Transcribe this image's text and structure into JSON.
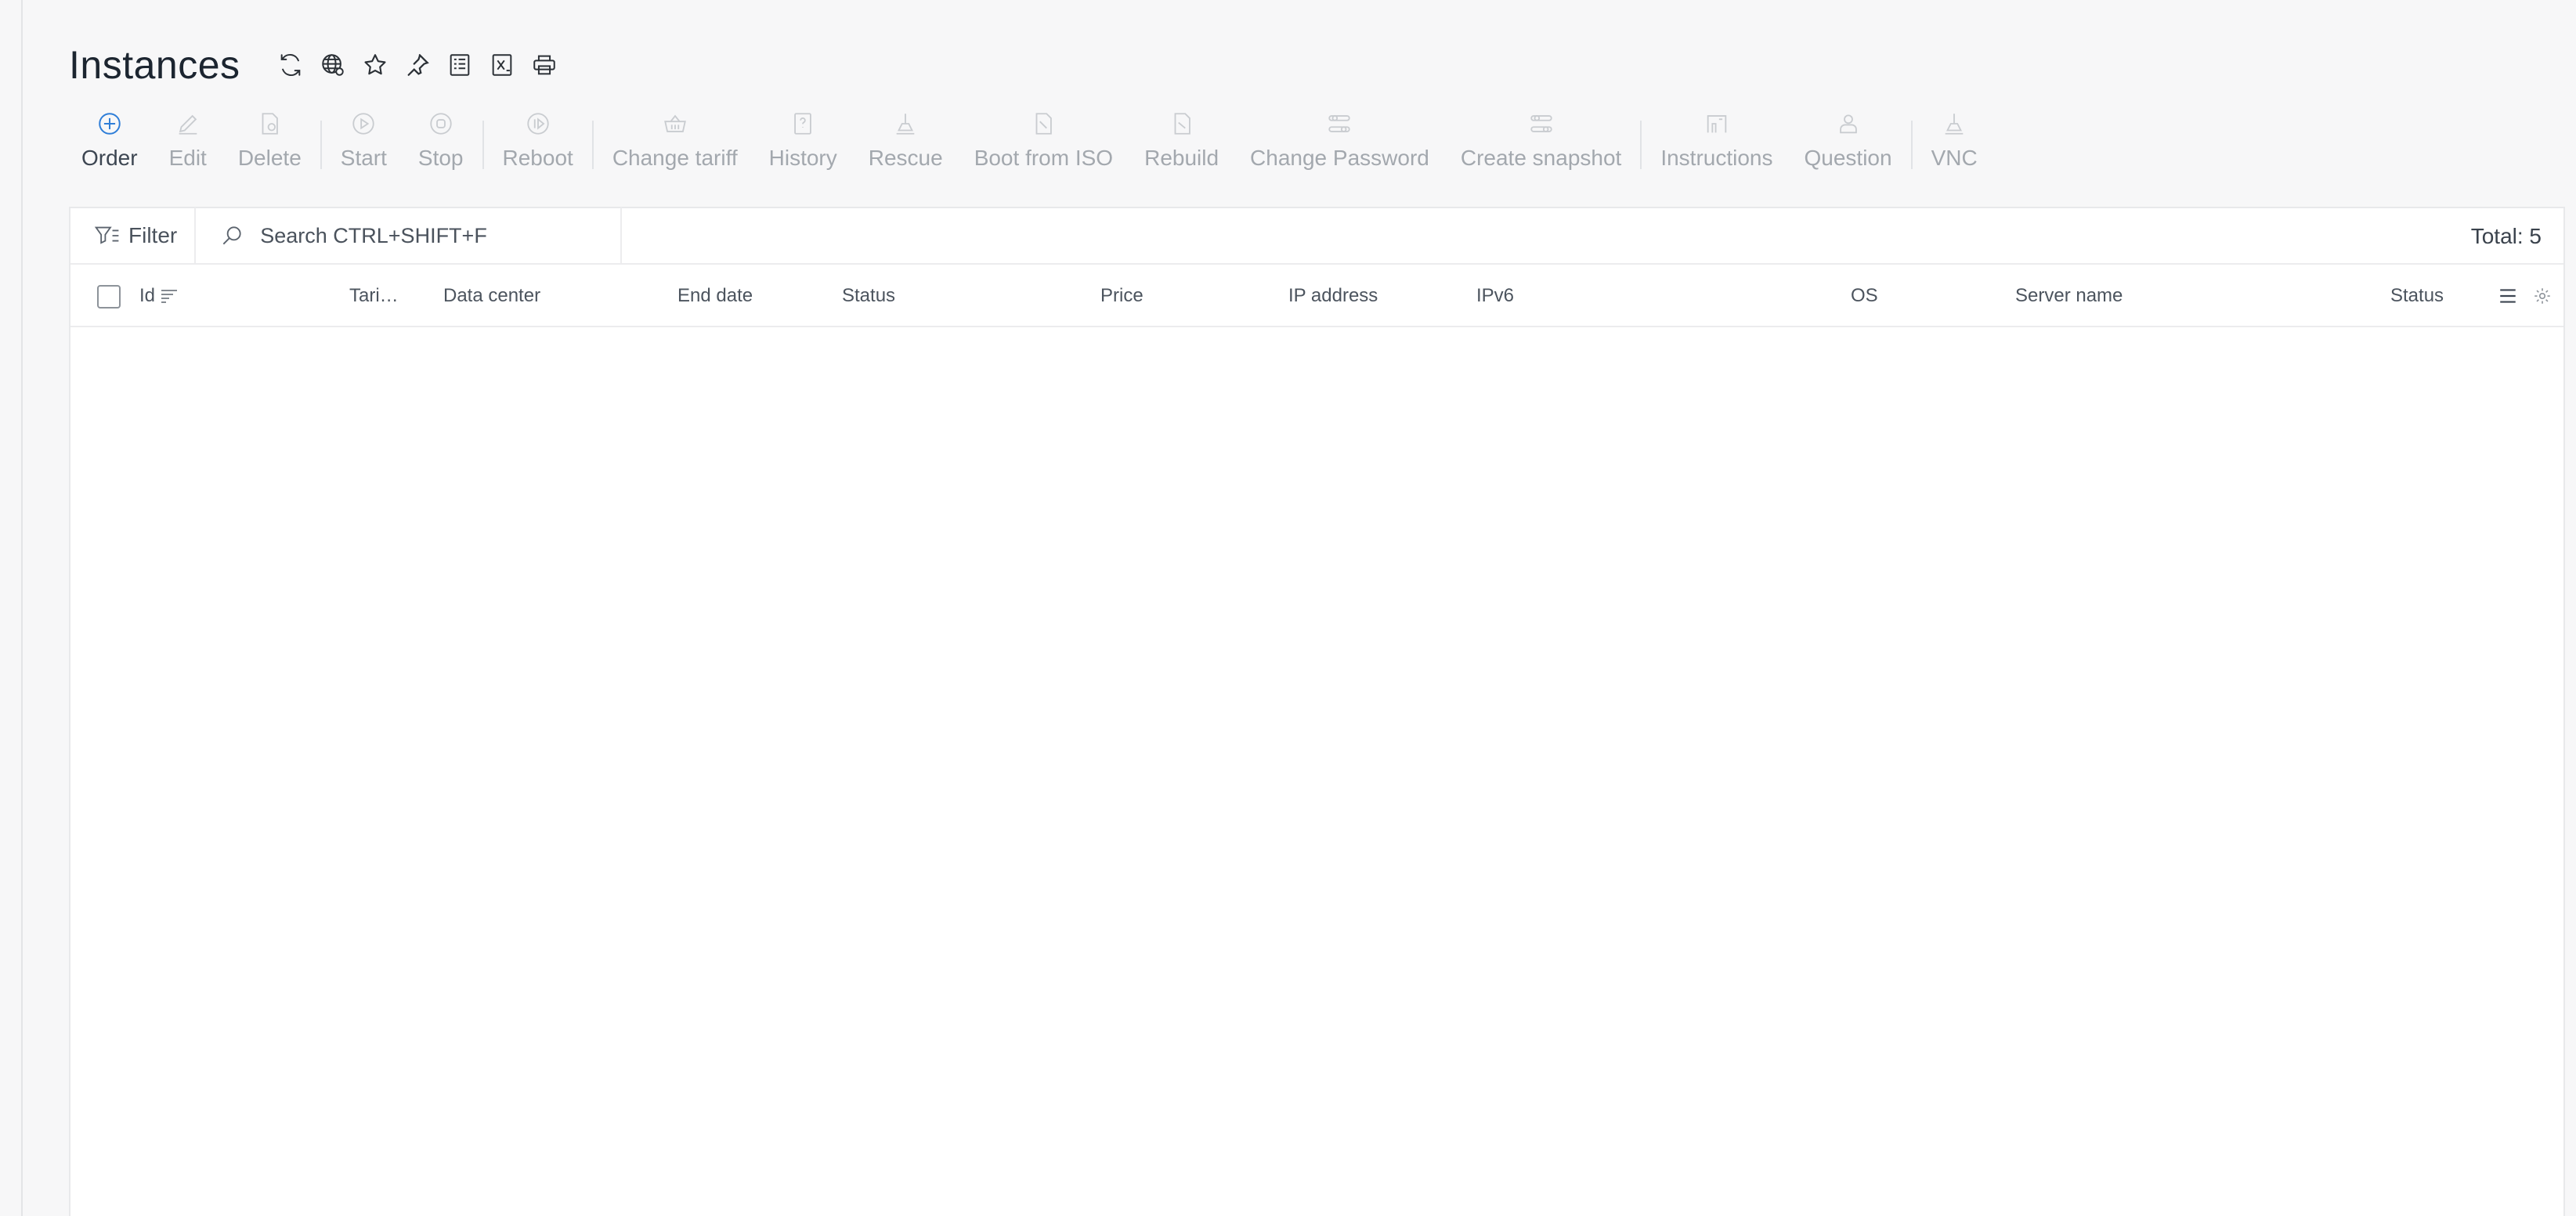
{
  "page": {
    "title": "Instances"
  },
  "header_icons": [
    {
      "name": "refresh-icon"
    },
    {
      "name": "globe-settings-icon"
    },
    {
      "name": "star-icon"
    },
    {
      "name": "pin-icon"
    },
    {
      "name": "list-document-icon"
    },
    {
      "name": "excel-export-icon"
    },
    {
      "name": "print-icon"
    }
  ],
  "toolbar": {
    "order": "Order",
    "edit": "Edit",
    "delete": "Delete",
    "start": "Start",
    "stop": "Stop",
    "reboot": "Reboot",
    "change_tariff": "Change tariff",
    "history": "History",
    "rescue": "Rescue",
    "boot_from_iso": "Boot from ISO",
    "rebuild": "Rebuild",
    "change_password": "Change Password",
    "create_snapshot": "Create snapshot",
    "instructions": "Instructions",
    "question": "Question",
    "vnc": "VNC"
  },
  "filter": {
    "label": "Filter"
  },
  "search": {
    "placeholder": "Search CTRL+SHIFT+F"
  },
  "total": "Total: 5",
  "table": {
    "columns": {
      "id": "Id",
      "tariff": "Tari…",
      "data_center": "Data center",
      "end_date": "End date",
      "status": "Status",
      "price": "Price",
      "ip_address": "IP address",
      "ipv6": "IPv6",
      "os": "OS",
      "server_name": "Server name",
      "status2": "Status"
    }
  },
  "colors": {
    "accent": "#2f7ed8",
    "muted": "#a3a8ae",
    "text": "#2b3036"
  }
}
